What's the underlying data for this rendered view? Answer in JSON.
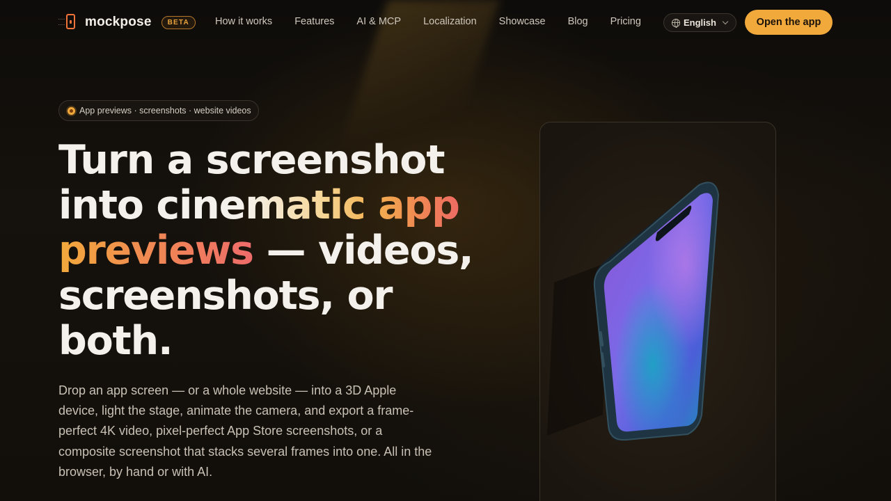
{
  "brand": {
    "name": "mockpose",
    "badge": "BETA"
  },
  "nav": {
    "links": [
      "How it works",
      "Features",
      "AI & MCP",
      "Localization",
      "Showcase",
      "Blog",
      "Pricing"
    ],
    "language": "English",
    "cta": "Open the app"
  },
  "hero": {
    "pill": "App previews · screenshots · website videos",
    "headline": {
      "part1": "Turn a screenshot into cine",
      "part2": "matic app ",
      "part3": "previews",
      "part4": " — videos, screenshots, or both."
    },
    "description": "Drop an app screen — or a whole website — into a 3D Apple device, light the stage, animate the camera, and export a frame-perfect 4K video, pixel-perfect App Store screenshots, or a composite screenshot that stacks several frames into one. All in the browser, by hand or with AI."
  },
  "colors": {
    "accent": "#f2a93b",
    "coral": "#ee6a63",
    "background": "#0d0b09"
  },
  "icons": {
    "logo": "phone-logo-icon",
    "language": "globe-icon",
    "dropdown": "chevron-down-icon"
  }
}
